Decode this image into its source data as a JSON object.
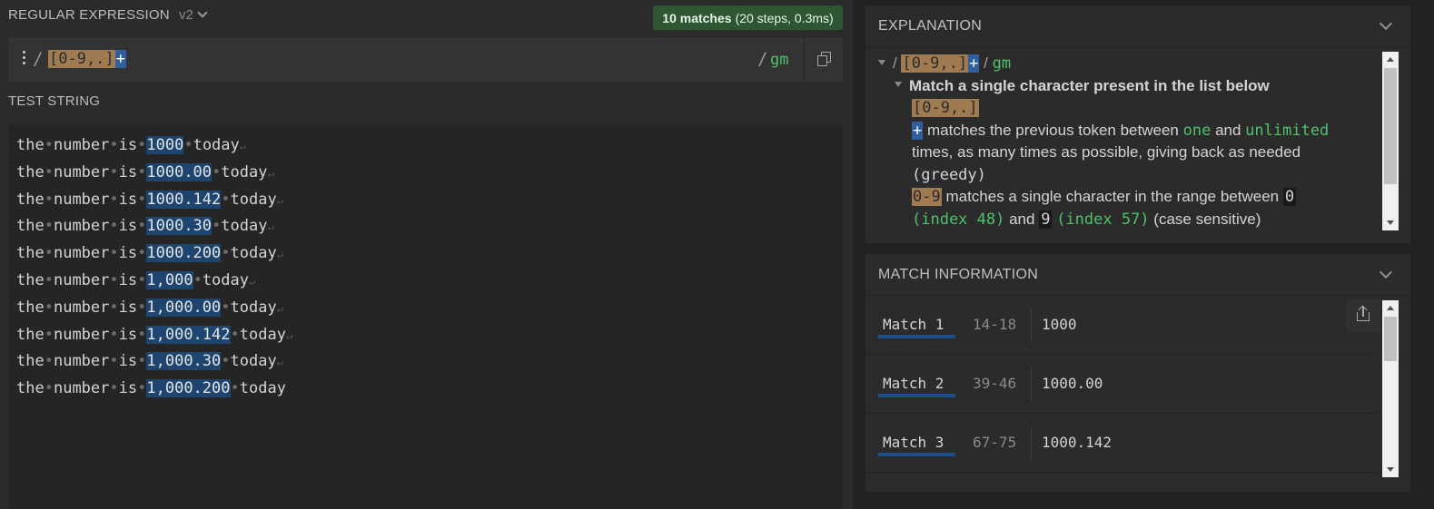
{
  "regex_header": {
    "title": "REGULAR EXPRESSION",
    "flavor": "v2",
    "match_count": "10 matches",
    "match_detail": "(20 steps, 0.3ms)"
  },
  "regex": {
    "open_delim": "/",
    "class_token": "[0-9,.]",
    "quantifier": "+",
    "close_delim": "/",
    "flags": "gm"
  },
  "test_string": {
    "title": "TEST STRING",
    "lines": [
      {
        "words": [
          "the",
          "number",
          "is"
        ],
        "match": "1000",
        "after": "today",
        "nl": true
      },
      {
        "words": [
          "the",
          "number",
          "is"
        ],
        "match": "1000.00",
        "after": "today",
        "nl": true
      },
      {
        "words": [
          "the",
          "number",
          "is"
        ],
        "match": "1000.142",
        "after": "today",
        "nl": true
      },
      {
        "words": [
          "the",
          "number",
          "is"
        ],
        "match": "1000.30",
        "after": "today",
        "nl": true
      },
      {
        "words": [
          "the",
          "number",
          "is"
        ],
        "match": "1000.200",
        "after": "today",
        "nl": true
      },
      {
        "words": [
          "the",
          "number",
          "is"
        ],
        "match": "1,000",
        "after": "today",
        "nl": true
      },
      {
        "words": [
          "the",
          "number",
          "is"
        ],
        "match": "1,000.00",
        "after": "today",
        "nl": true
      },
      {
        "words": [
          "the",
          "number",
          "is"
        ],
        "match": "1,000.142",
        "after": "today",
        "nl": true
      },
      {
        "words": [
          "the",
          "number",
          "is"
        ],
        "match": "1,000.30",
        "after": "today",
        "nl": true
      },
      {
        "words": [
          "the",
          "number",
          "is"
        ],
        "match": "1,000.200",
        "after": "today",
        "nl": false
      }
    ],
    "space_glyph": "•",
    "newline_glyph": "↵"
  },
  "explanation": {
    "title": "EXPLANATION",
    "root_slash_open": "/",
    "root_class": "[0-9,.]",
    "root_quant": "+",
    "root_slash_close": "/",
    "root_flags": "gm",
    "heading": "Match a single character present in the list below",
    "class_token": "[0-9,.]",
    "quant_token": "+",
    "quant_text_1": "matches the previous token between",
    "quant_one": "one",
    "quant_and": "and",
    "quant_unlimited": "unlimited",
    "quant_text_2": "times, as many times as possible, giving back as needed",
    "quant_greedy": "(greedy)",
    "range_token": "0-9",
    "range_text": "matches a single character in the range between",
    "range_from": "0",
    "range_from_index": "(index 48)",
    "range_and": "and",
    "range_to": "9",
    "range_to_index": "(index 57)",
    "range_case": "(case sensitive)"
  },
  "match_info": {
    "title": "MATCH INFORMATION",
    "rows": [
      {
        "name": "Match 1",
        "range": "14-18",
        "value": "1000"
      },
      {
        "name": "Match 2",
        "range": "39-46",
        "value": "1000.00"
      },
      {
        "name": "Match 3",
        "range": "67-75",
        "value": "1000.142"
      }
    ]
  },
  "colors": {
    "class_token": "#a07b52",
    "quantifier": "#2f5f9e",
    "match_highlight": "#1d4570",
    "flags_green": "#4fc16b",
    "badge_bg": "#2e5632"
  },
  "icons": [
    "menu-dots-icon",
    "copy-icon",
    "chevron-down-icon",
    "share-icon",
    "tree-toggle-icon"
  ]
}
